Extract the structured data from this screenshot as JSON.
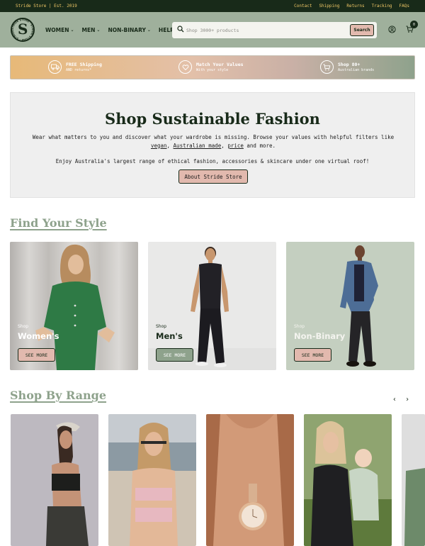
{
  "topbar": {
    "est": "Stride Store | Est. 2019",
    "links": [
      "Contact",
      "Shipping",
      "Returns",
      "Tracking",
      "FAQs"
    ]
  },
  "header": {
    "logo_text": "STRIDE STORE",
    "nav": [
      "WOMEN",
      "MEN",
      "NON-BINARY",
      "HELP"
    ],
    "search": {
      "placeholder": "Shop 3000+ products",
      "button": "Search"
    },
    "cart_count": "0"
  },
  "promo": [
    {
      "title": "FREE Shipping",
      "sub": "AND returns*",
      "icon": "truck-icon"
    },
    {
      "title": "Match Your Values",
      "sub": "With your style",
      "icon": "heart-tag-icon"
    },
    {
      "title": "Shop 80+",
      "sub": "Australian brands",
      "icon": "shop-cart-icon"
    }
  ],
  "hero": {
    "title": "Shop Sustainable Fashion",
    "p1_a": "Wear what matters to you and discover what your wardrobe is missing. Browse your values with helpful filters like ",
    "p1_vegan": "vegan",
    "p1_comma": ",",
    "p1_aus": "Australian made",
    "p1_comma2": ", ",
    "p1_price": "price",
    "p1_end": " and more.",
    "p2": "Enjoy Australia's largest range of ethical fashion, accessories & skincare under one virtual roof!",
    "button": "About Stride Store"
  },
  "find_style": {
    "title": "Find Your Style",
    "cards": [
      {
        "shop": "Shop",
        "name": "Women's",
        "button": "SEE MORE",
        "button_color": "#e2b9ae"
      },
      {
        "shop": "Shop",
        "name": "Men's",
        "button": "SEE MORE",
        "button_color": "#8ea28c"
      },
      {
        "shop": "Shop",
        "name": "Non-Binary",
        "button": "SEE MORE",
        "button_color": "#e2b9ae"
      }
    ]
  },
  "shop_range": {
    "title": "Shop By Range",
    "prev": "‹",
    "next": "›"
  },
  "colors": {
    "dark_green": "#182a19",
    "sage": "#8ea28c",
    "blush": "#e2b9ae",
    "gold": "#f0c766"
  }
}
